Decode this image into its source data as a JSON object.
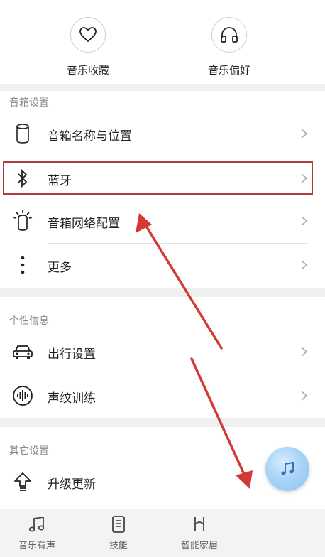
{
  "shortcuts": [
    {
      "label": "音乐收藏",
      "icon": "heart-icon"
    },
    {
      "label": "音乐偏好",
      "icon": "headphones-icon"
    }
  ],
  "sections": {
    "speaker": {
      "title": "音箱设置",
      "items": [
        {
          "label": "音箱名称与位置",
          "icon": "speaker-icon"
        },
        {
          "label": "蓝牙",
          "icon": "bluetooth-icon"
        },
        {
          "label": "音箱网络配置",
          "icon": "network-lamp-icon"
        },
        {
          "label": "更多",
          "icon": "more-vertical-icon"
        }
      ]
    },
    "personal": {
      "title": "个性信息",
      "items": [
        {
          "label": "出行设置",
          "icon": "car-icon"
        },
        {
          "label": "声纹训练",
          "icon": "voiceprint-icon"
        }
      ]
    },
    "other": {
      "title": "其它设置",
      "items": [
        {
          "label": "升级更新",
          "icon": "upgrade-arrow-icon"
        }
      ]
    }
  },
  "tabs": [
    {
      "label": "音乐有声",
      "icon": "music-note-icon"
    },
    {
      "label": "技能",
      "icon": "book-icon"
    },
    {
      "label": "智能家居",
      "icon": "smart-home-icon"
    }
  ],
  "colors": {
    "highlight_border": "#b13a3a",
    "annotation_arrow": "#d23b34",
    "fab": "#a9d4f7"
  }
}
